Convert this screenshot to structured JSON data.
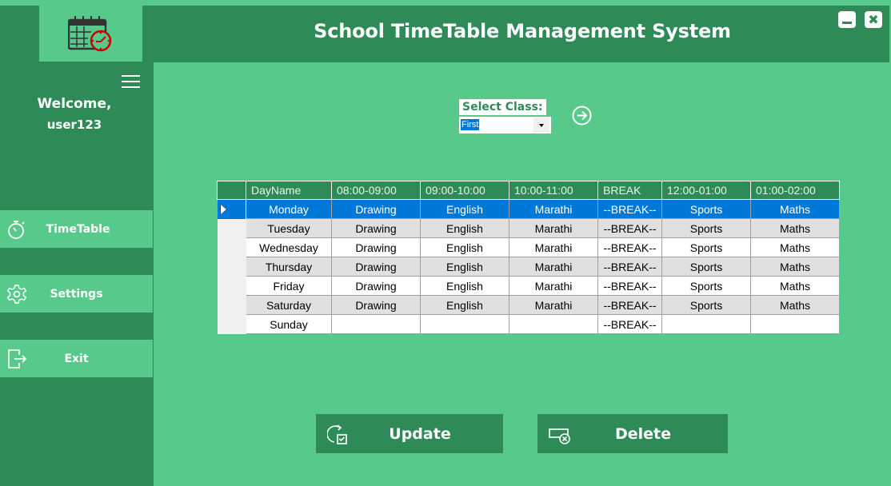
{
  "window": {
    "title": "School TimeTable Management System",
    "minimize_icon": "minimize-icon",
    "close_icon": "close-icon",
    "close_glyph": "✖"
  },
  "logo": {
    "icon": "calendar-clock-icon"
  },
  "sidebar": {
    "menu_icon": "hamburger-icon",
    "welcome_line": "Welcome,",
    "username": "user123",
    "items": [
      {
        "label": "TimeTable",
        "icon": "stopwatch-icon"
      },
      {
        "label": "Settings",
        "icon": "gear-icon"
      },
      {
        "label": "Exit",
        "icon": "exit-icon"
      }
    ]
  },
  "class_selector": {
    "label": "Select Class:",
    "selected": "First",
    "go_icon": "arrow-right-circle-icon"
  },
  "timetable": {
    "columns": [
      "DayName",
      "08:00-09:00",
      "09:00-10:00",
      "10:00-11:00",
      "BREAK",
      "12:00-01:00",
      "01:00-02:00"
    ],
    "selected_row": 0,
    "rows": [
      [
        "Monday",
        "Drawing",
        "English",
        "Marathi",
        "--BREAK--",
        "Sports",
        "Maths"
      ],
      [
        "Tuesday",
        "Drawing",
        "English",
        "Marathi",
        "--BREAK--",
        "Sports",
        "Maths"
      ],
      [
        "Wednesday",
        "Drawing",
        "English",
        "Marathi",
        "--BREAK--",
        "Sports",
        "Maths"
      ],
      [
        "Thursday",
        "Drawing",
        "English",
        "Marathi",
        "--BREAK--",
        "Sports",
        "Maths"
      ],
      [
        "Friday",
        "Drawing",
        "English",
        "Marathi",
        "--BREAK--",
        "Sports",
        "Maths"
      ],
      [
        "Saturday",
        "Drawing",
        "English",
        "Marathi",
        "--BREAK--",
        "Sports",
        "Maths"
      ],
      [
        "Sunday",
        "",
        "",
        "",
        "--BREAK--",
        "",
        ""
      ]
    ]
  },
  "actions": {
    "update_label": "Update",
    "update_icon": "refresh-check-icon",
    "delete_label": "Delete",
    "delete_icon": "delete-row-icon"
  },
  "colors": {
    "primary_dark": "#2e8b57",
    "primary_light": "#57c98b",
    "selection": "#0078d7"
  }
}
